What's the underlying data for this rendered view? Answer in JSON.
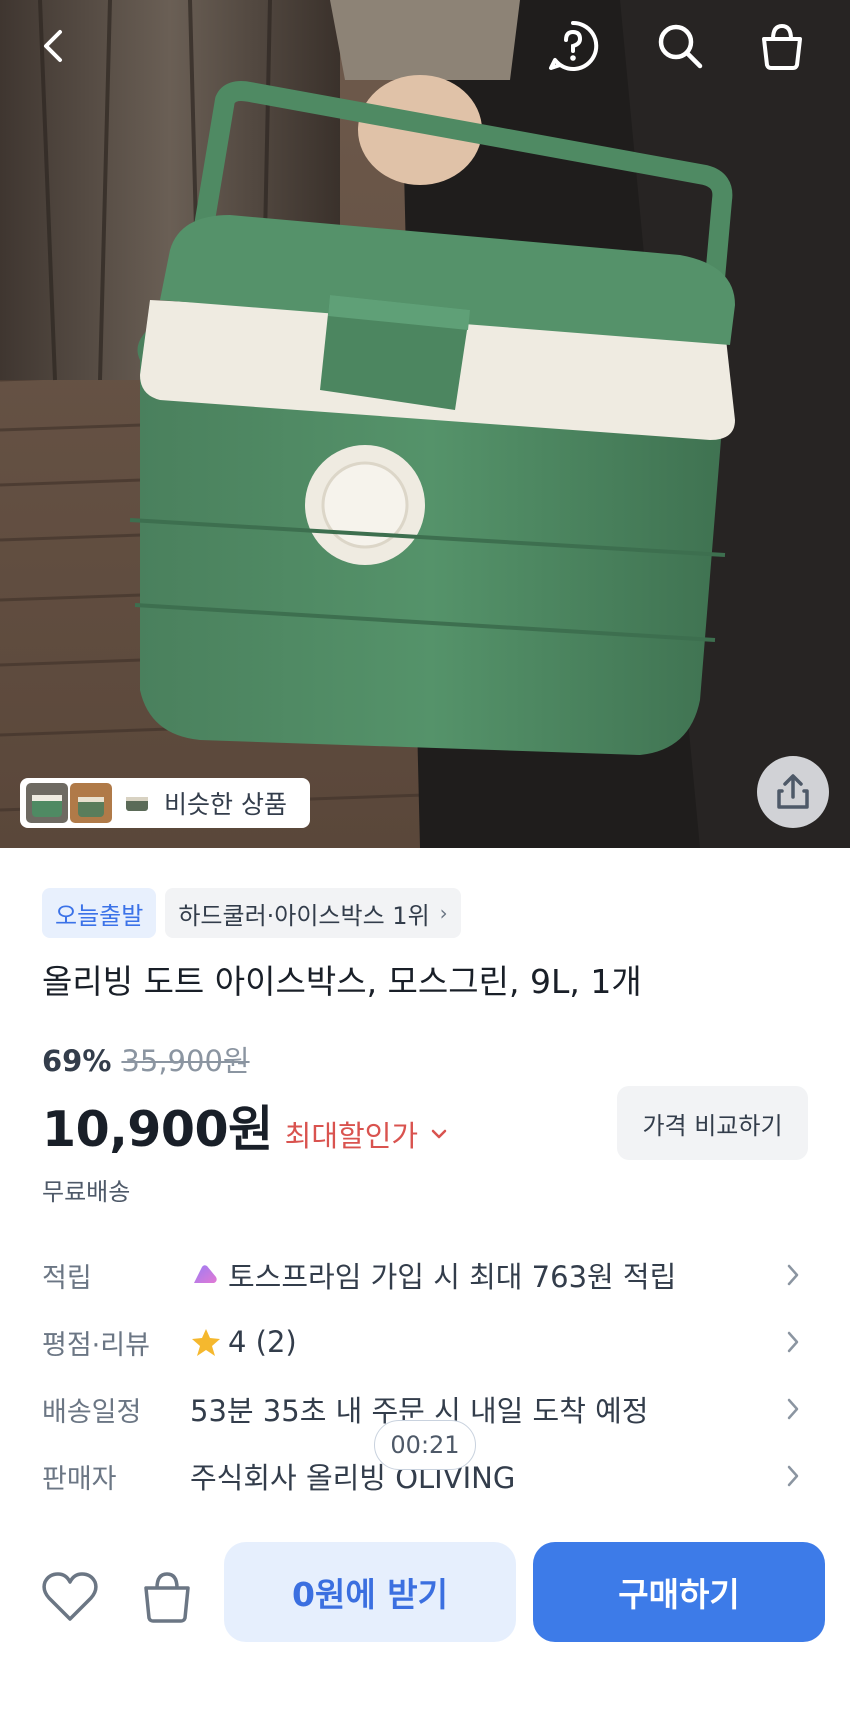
{
  "header": {
    "back_icon": "chevron-left-icon",
    "help_icon": "question-circle-icon",
    "search_icon": "search-icon",
    "cart_icon": "shopping-bag-icon"
  },
  "hero": {
    "similar_label": "비슷한 상품",
    "share_icon": "share-icon"
  },
  "product": {
    "badge_today": "오늘출발",
    "badge_rank": "하드쿨러·아이스박스 1위",
    "title": "올리빙 도트 아이스박스, 모스그린, 9L, 1개",
    "discount_percent": "69%",
    "original_price": "35,900원",
    "price": "10,900원",
    "best_price_label": "최대할인가",
    "compare_label": "가격 비교하기",
    "shipping": "무료배송"
  },
  "info_rows": [
    {
      "label": "적립",
      "value": "토스프라임 가입 시 최대 763원 적립"
    },
    {
      "label": "평점·리뷰",
      "value": "4 (2)",
      "rating": 4,
      "review_count": 2
    },
    {
      "label": "배송일정",
      "value": "53분 35초 내 주문 시 내일 도착 예정"
    },
    {
      "label": "판매자",
      "value": "주식회사 올리빙 OLIVING"
    }
  ],
  "timer": "00:21",
  "bottom": {
    "free_label": "0원에 받기",
    "buy_label": "구매하기"
  },
  "colors": {
    "accent": "#3d7be8",
    "accent_light": "#e6effd",
    "sale_red": "#d9534f",
    "product_green": "#4f8a63"
  }
}
